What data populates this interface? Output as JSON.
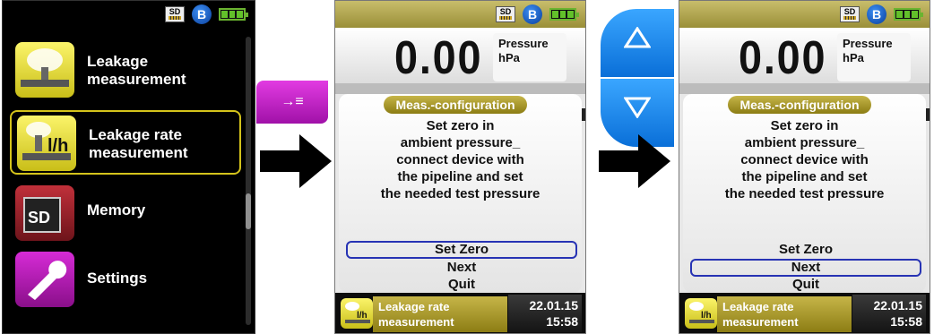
{
  "menu": {
    "items": [
      {
        "label_line1": "Leakage",
        "label_line2": "measurement",
        "icon": "leakage-icon"
      },
      {
        "label_line1": "Leakage rate",
        "label_line2": "measurement",
        "icon": "leakage-rate-icon"
      },
      {
        "label_line1": "Memory",
        "label_line2": "",
        "icon": "sd-memory-icon"
      },
      {
        "label_line1": "Settings",
        "label_line2": "",
        "icon": "wrench-icon"
      }
    ],
    "selected_index": 1
  },
  "status": {
    "sd_label": "SD",
    "bluetooth_label": "B",
    "battery_level": 1.0
  },
  "keys": {
    "enter_label": "→≡"
  },
  "tile_texts": {
    "rate": "l/h",
    "sd": "SD"
  },
  "device": {
    "value": "0.00",
    "unit_name": "Pressure",
    "unit": "hPa",
    "panel_title": "Meas.-configuration",
    "message_lines": [
      "Set zero in",
      "ambient pressure_",
      "connect device with",
      "the pipeline and set",
      "the needed test pressure"
    ],
    "options": [
      "Set Zero",
      "Next",
      "Quit"
    ],
    "footer_name_line1": "Leakage rate",
    "footer_name_line2": "measurement",
    "date": "22.01.15",
    "time": "15:58",
    "footer_icon_text": "l/h"
  },
  "screens": [
    {
      "selected_option": "Set Zero"
    },
    {
      "selected_option": "Next"
    }
  ],
  "colors": {
    "accent_yellow": "#d4c31b",
    "select_blue": "#2733b4",
    "key_magenta": "#c024c8",
    "key_blue": "#1587f0"
  }
}
